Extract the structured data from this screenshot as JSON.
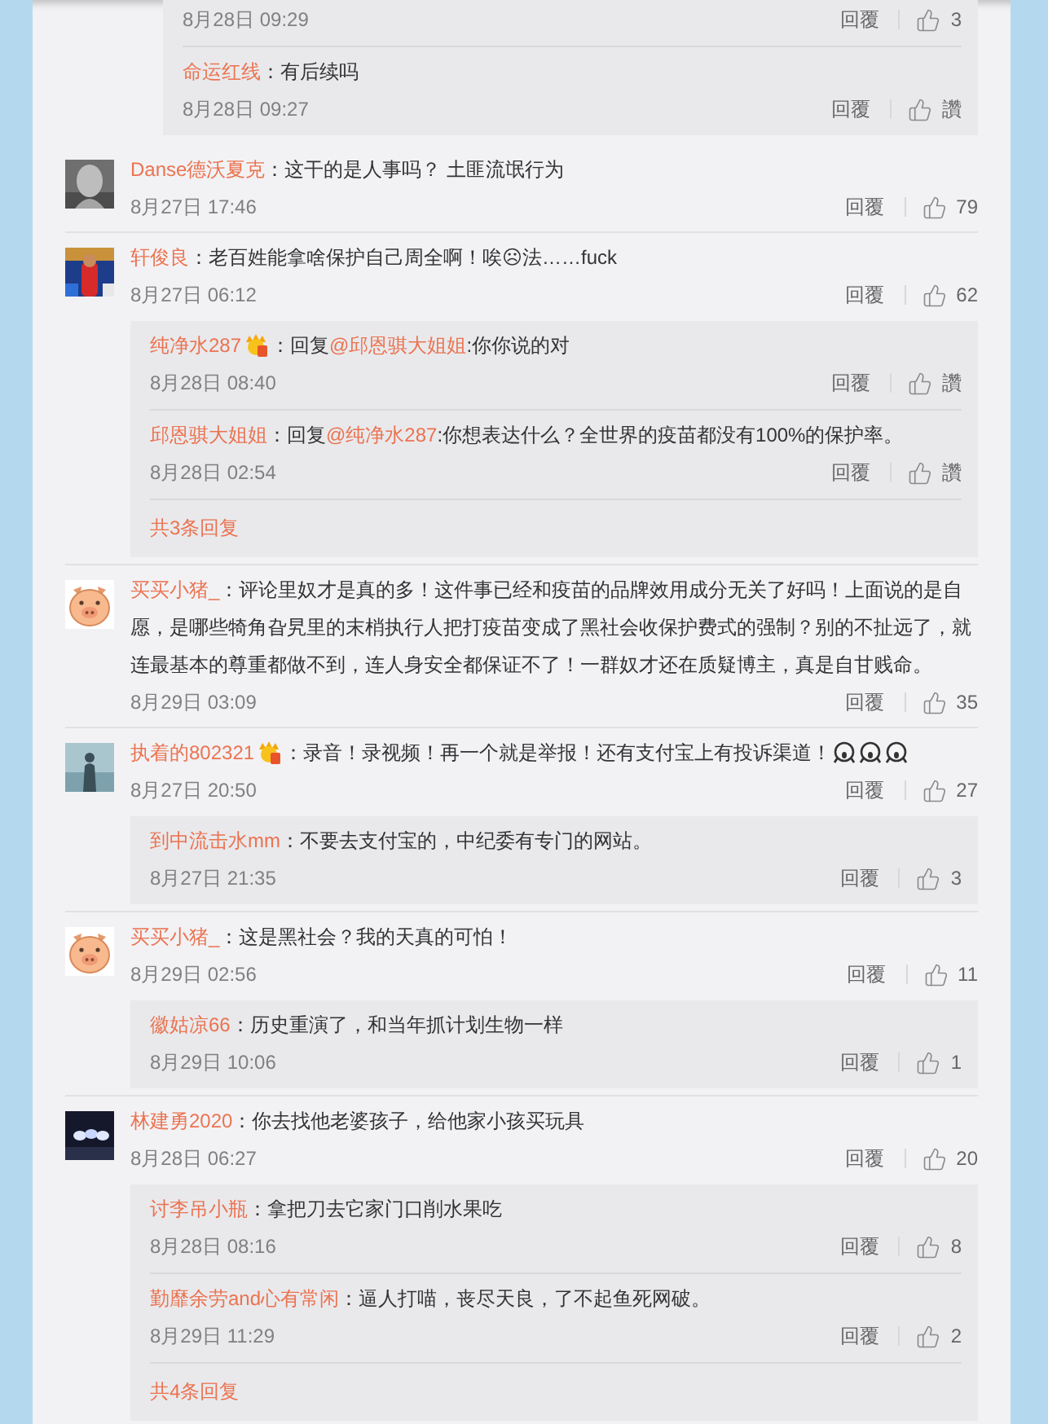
{
  "leading_replies": [
    {
      "time": "8月28日 09:29",
      "reply_label": "回覆",
      "likes": "3"
    },
    {
      "user": "命运红线",
      "text": "：有后续吗",
      "time": "8月28日 09:27",
      "reply_label": "回覆",
      "likes": "讚"
    }
  ],
  "comments": [
    {
      "avatar": {
        "kind": "picture"
      },
      "user": "Danse德沃夏克",
      "text": "：这干的是人事吗？ 土匪流氓行为",
      "time": "8月27日 17:46",
      "reply_label": "回覆",
      "likes": "79"
    },
    {
      "avatar": {
        "kind": "picture"
      },
      "user": "轩俊良",
      "text": "：老百姓能拿啥保护自己周全啊！唉☹法……fuck",
      "time": "8月27日 06:12",
      "reply_label": "回覆",
      "likes": "62",
      "replies": [
        {
          "user": "纯净水287",
          "badge": true,
          "reply_prefix": "：回复",
          "mention": "@邱恩骐大姐姐",
          "text": ":你你说的对",
          "time": "8月28日 08:40",
          "reply_label": "回覆",
          "likes": "讚"
        },
        {
          "user": "邱恩骐大姐姐",
          "reply_prefix": "：回复",
          "mention": "@纯净水287",
          "text": ":你想表达什么？全世界的疫苗都没有100%的保护率。",
          "time": "8月28日 02:54",
          "reply_label": "回覆",
          "likes": "讚"
        }
      ],
      "more": "共3条回复"
    },
    {
      "avatar": {
        "kind": "pig"
      },
      "user": "买买小猪_",
      "text": "：评论里奴才是真的多！这件事已经和疫苗的品牌效用成分无关了好吗！上面说的是自愿，是哪些犄角旮旯里的末梢执行人把打疫苗变成了黑社会收保护费式的强制？别的不扯远了，就连最基本的尊重都做不到，连人身安全都保证不了！一群奴才还在质疑博主，真是自甘贱命。",
      "time": "8月29日 03:09",
      "reply_label": "回覆",
      "likes": "35"
    },
    {
      "avatar": {
        "kind": "picture"
      },
      "user": "执着的802321",
      "badge": true,
      "text": "：录音！录视频！再一个就是举报！还有支付宝上有投诉渠道！",
      "emojis": [
        {
          "kind": "scream"
        },
        {
          "kind": "scream"
        },
        {
          "kind": "scream"
        }
      ],
      "time": "8月27日 20:50",
      "reply_label": "回覆",
      "likes": "27",
      "replies": [
        {
          "user": "到中流击水mm",
          "text": "：不要去支付宝的，中纪委有专门的网站。",
          "time": "8月27日 21:35",
          "reply_label": "回覆",
          "likes": "3"
        }
      ]
    },
    {
      "avatar": {
        "kind": "pig"
      },
      "user": "买买小猪_",
      "text": "：这是黑社会？我的天真的可怕！",
      "time": "8月29日 02:56",
      "reply_label": "回覆",
      "likes": "11",
      "replies": [
        {
          "user": "徽姑凉66",
          "text": "：历史重演了，和当年抓计划生物一样",
          "time": "8月29日 10:06",
          "reply_label": "回覆",
          "likes": "1"
        }
      ]
    },
    {
      "avatar": {
        "kind": "picture"
      },
      "user": "林建勇2020",
      "text": "：你去找他老婆孩子，给他家小孩买玩具",
      "time": "8月28日 06:27",
      "reply_label": "回覆",
      "likes": "20",
      "replies": [
        {
          "user": "讨李吊小瓶",
          "text": "：拿把刀去它家门口削水果吃",
          "time": "8月28日 08:16",
          "reply_label": "回覆",
          "likes": "8"
        },
        {
          "user": "勤靡余劳and心有常闲",
          "text": "：逼人打喵，丧尽天良，了不起鱼死网破。",
          "time": "8月29日 11:29",
          "reply_label": "回覆",
          "likes": "2"
        }
      ],
      "more": "共4条回复"
    }
  ]
}
